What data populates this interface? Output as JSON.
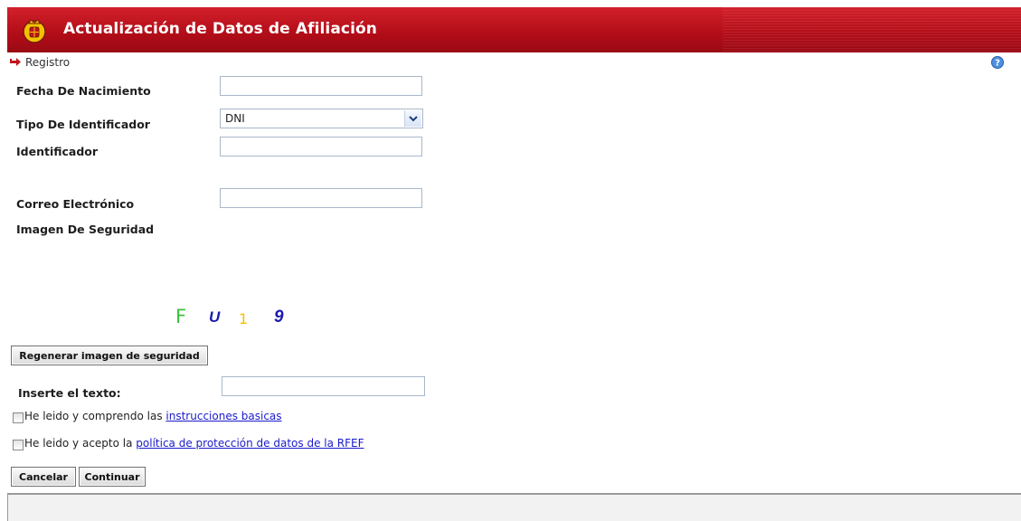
{
  "header": {
    "title": "Actualización de Datos de Afiliación"
  },
  "breadcrumb": {
    "label": "Registro"
  },
  "form": {
    "fecha_label": "Fecha De Nacimiento",
    "fecha_value": "",
    "tipo_label": "Tipo De Identificador",
    "tipo_value": "DNI",
    "identificador_label": "Identificador",
    "identificador_value": "",
    "correo_label": "Correo Electrónico",
    "correo_value": "",
    "imagen_label": "Imagen De Seguridad",
    "captcha_chars": [
      "F",
      "U",
      "1",
      "9"
    ],
    "regenerar_label": "Regenerar imagen de seguridad",
    "inserte_label": "Inserte el texto:",
    "inserte_value": "",
    "check1_text": "He leido y comprendo las",
    "check1_link": "instrucciones basicas",
    "check2_text": "He leido y acepto la",
    "check2_link": "política de protección de datos de la RFEF",
    "cancelar_label": "Cancelar",
    "continuar_label": "Continuar"
  },
  "icons": {
    "logo": "rfef-crest-icon",
    "breadcrumb": "arrow-right-icon",
    "help": "help-icon"
  },
  "colors": {
    "header": "#c0151f",
    "link": "#1a1acc"
  }
}
